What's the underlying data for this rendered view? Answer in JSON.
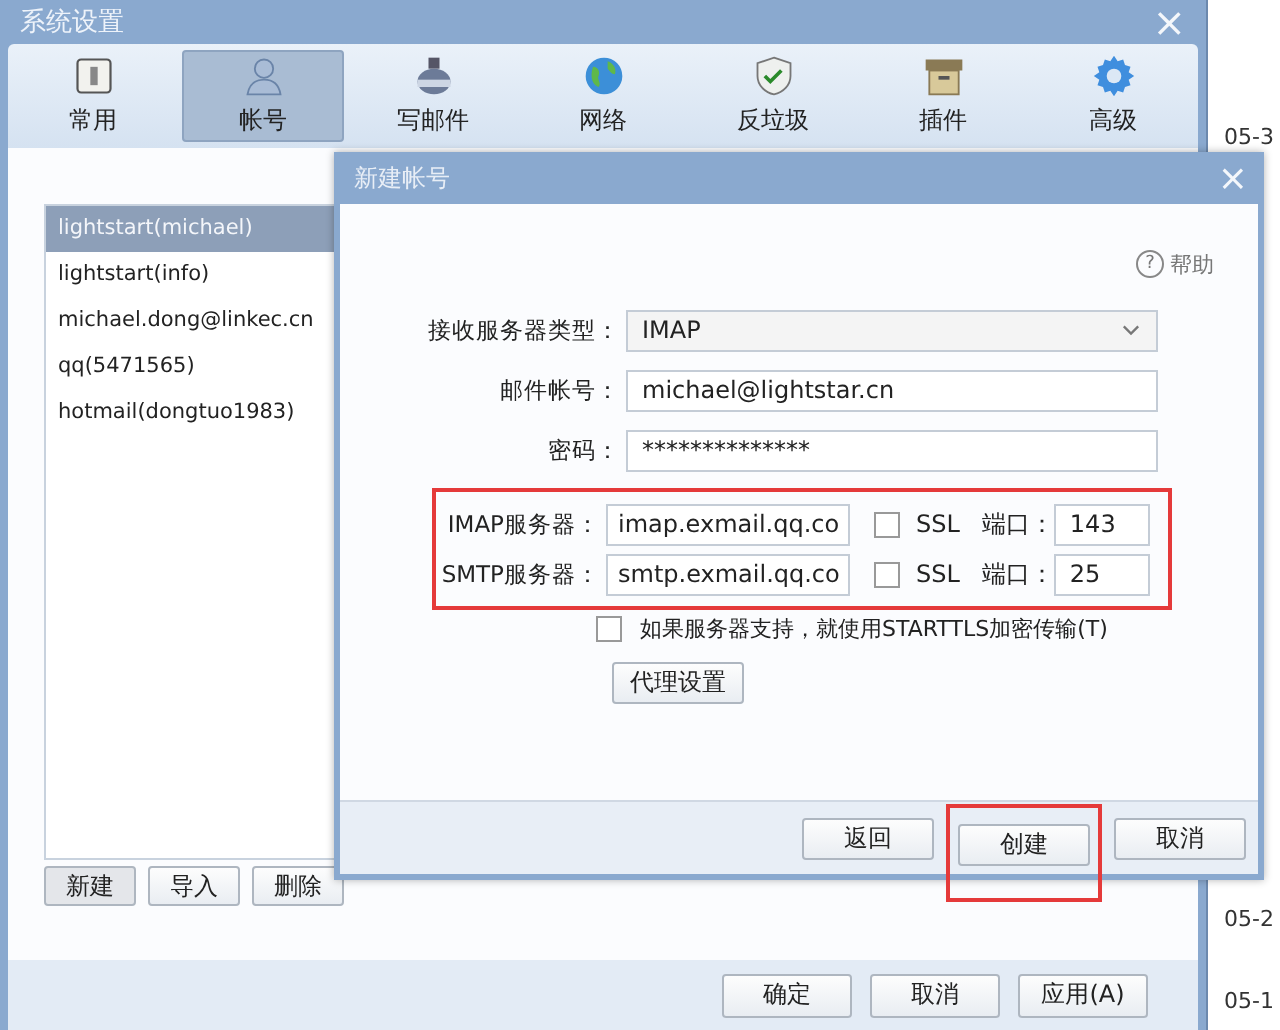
{
  "window": {
    "title": "系统设置",
    "close": "×"
  },
  "tabs": [
    {
      "label": "常用",
      "kind": "switch",
      "selected": false
    },
    {
      "label": "帐号",
      "kind": "person",
      "selected": true
    },
    {
      "label": "写邮件",
      "kind": "ink",
      "selected": false
    },
    {
      "label": "网络",
      "kind": "globe",
      "selected": false
    },
    {
      "label": "反垃圾",
      "kind": "shield",
      "selected": false
    },
    {
      "label": "插件",
      "kind": "box",
      "selected": false
    },
    {
      "label": "高级",
      "kind": "gear",
      "selected": false
    }
  ],
  "accounts": [
    {
      "label": "lightstart(michael)",
      "selected": true
    },
    {
      "label": "lightstart(info)",
      "selected": false
    },
    {
      "label": "michael.dong@linkec.cn",
      "selected": false
    },
    {
      "label": "qq(5471565)",
      "selected": false
    },
    {
      "label": "hotmail(dongtuo1983)",
      "selected": false
    }
  ],
  "account_buttons": [
    {
      "label": "新建",
      "selected": true
    },
    {
      "label": "导入",
      "selected": false
    },
    {
      "label": "删除",
      "selected": false
    }
  ],
  "footer_buttons": [
    "确定",
    "取消",
    "应用(A)"
  ],
  "dialog": {
    "title": "新建帐号",
    "close": "×",
    "help": "帮助",
    "help_icon": "?",
    "fields": [
      {
        "label": "接收服务器类型：",
        "kind": "select",
        "value": "IMAP"
      },
      {
        "label": "邮件帐号：",
        "kind": "text",
        "value": "michael@lightstar.cn"
      },
      {
        "label": "密码：",
        "kind": "text",
        "value": "**************"
      }
    ],
    "servers": {
      "highlighted": true,
      "rows": [
        {
          "label": "IMAP服务器：",
          "value": "imap.exmail.qq.co",
          "ssl_label": "SSL",
          "ssl": false,
          "port_label": "端口：",
          "port": "143"
        },
        {
          "label": "SMTP服务器：",
          "value": "smtp.exmail.qq.co",
          "ssl_label": "SSL",
          "ssl": false,
          "port_label": "端口：",
          "port": "25"
        }
      ]
    },
    "starttls": {
      "label": "如果服务器支持，就使用STARTTLS加密传输(T)",
      "checked": false
    },
    "proxy_button": "代理设置",
    "buttons": [
      {
        "label": "返回",
        "highlighted": false
      },
      {
        "label": "创建",
        "highlighted": true
      },
      {
        "label": "取消",
        "highlighted": false
      }
    ]
  },
  "background_dates": [
    "05-3",
    "05-2",
    "05-1"
  ]
}
